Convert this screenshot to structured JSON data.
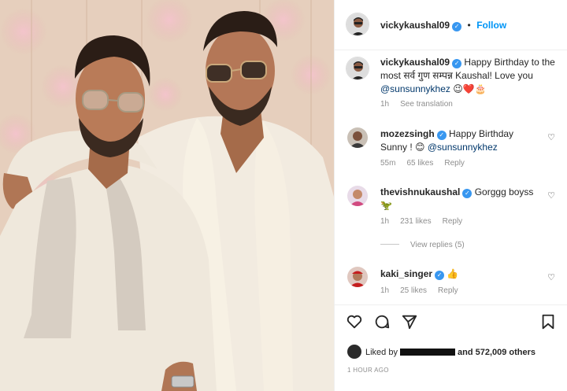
{
  "post": {
    "author": "vickykaushal09",
    "follow_label": "Follow",
    "dot": "•",
    "photo_alt": "Two men in cream kurtas posing together"
  },
  "caption": {
    "username": "vickykaushal09",
    "text_start": "Happy Birthday to the most सर्व गुण सम्पन्न Kaushal! Love you ",
    "mention": "@sunsunnykhez",
    "emojis": "😉❤️🎂",
    "age": "1h",
    "see_translation": "See translation"
  },
  "comments": [
    {
      "username": "mozezsingh",
      "text": "Happy Birthday Sunny ! 😊 ",
      "mention": "@sunsunnykhez",
      "age": "55m",
      "likes": "65 likes",
      "reply": "Reply"
    },
    {
      "username": "thevishnukaushal",
      "text": "Gorggg boyss",
      "emoji": "🦖",
      "age": "1h",
      "likes": "231 likes",
      "reply": "Reply"
    },
    {
      "username": "kaki_singer",
      "emoji": "👍",
      "age": "1h",
      "likes": "25 likes",
      "reply": "Reply"
    }
  ],
  "view_replies": "View replies (5)",
  "likes_line": {
    "prefix": "Liked by",
    "suffix": "and 572,009 others"
  },
  "timestamp": "1 HOUR AGO",
  "colors": {
    "accent": "#0095f6",
    "verified": "#3897f0",
    "muted": "#8e8e8e"
  },
  "icons": [
    "heart-icon",
    "comment-icon",
    "share-icon",
    "bookmark-icon",
    "verified-icon",
    "thumbs-up-emoji"
  ]
}
